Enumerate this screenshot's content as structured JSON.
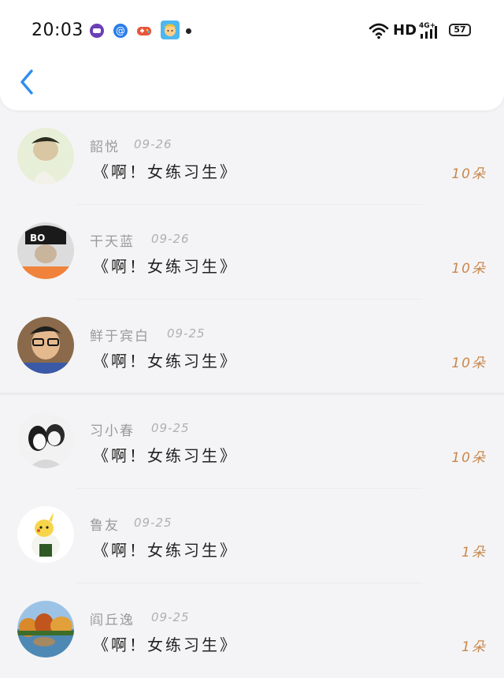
{
  "status_bar": {
    "time": "20:03",
    "network_label": "HD",
    "signal_label": "4G+",
    "battery": "57",
    "icons": [
      "purple-app-icon",
      "email-icon",
      "game-controller-icon",
      "cartoon-avatar-icon",
      "notification-dot"
    ]
  },
  "header": {
    "back_icon": "chevron-left-icon",
    "accent": "#2f8ef0"
  },
  "list": [
    {
      "name": "韶悦",
      "date": "09-26",
      "title": "《啊！女练习生》",
      "count": "10朵",
      "avatar_color": "#e8efd8"
    },
    {
      "name": "干天蓝",
      "date": "09-26",
      "title": "《啊！女练习生》",
      "count": "10朵",
      "avatar_color": "#2a2a2a"
    },
    {
      "name": "鲜于宾白",
      "date": "09-25",
      "title": "《啊！女练习生》",
      "count": "10朵",
      "avatar_color": "#8a6a4a"
    },
    {
      "name": "习小春",
      "date": "09-25",
      "title": "《啊！女练习生》",
      "count": "10朵",
      "avatar_color": "#e6e6e6"
    },
    {
      "name": "鲁友",
      "date": "09-25",
      "title": "《啊！女练习生》",
      "count": "1朵",
      "avatar_color": "#ffffff"
    },
    {
      "name": "阎丘逸",
      "date": "09-25",
      "title": "《啊！女练习生》",
      "count": "1朵",
      "avatar_color": "#d07a2a"
    }
  ],
  "colors": {
    "name": "#9a9a9a",
    "date": "#b0b0b0",
    "title": "#222222",
    "count": "#c9874a"
  }
}
